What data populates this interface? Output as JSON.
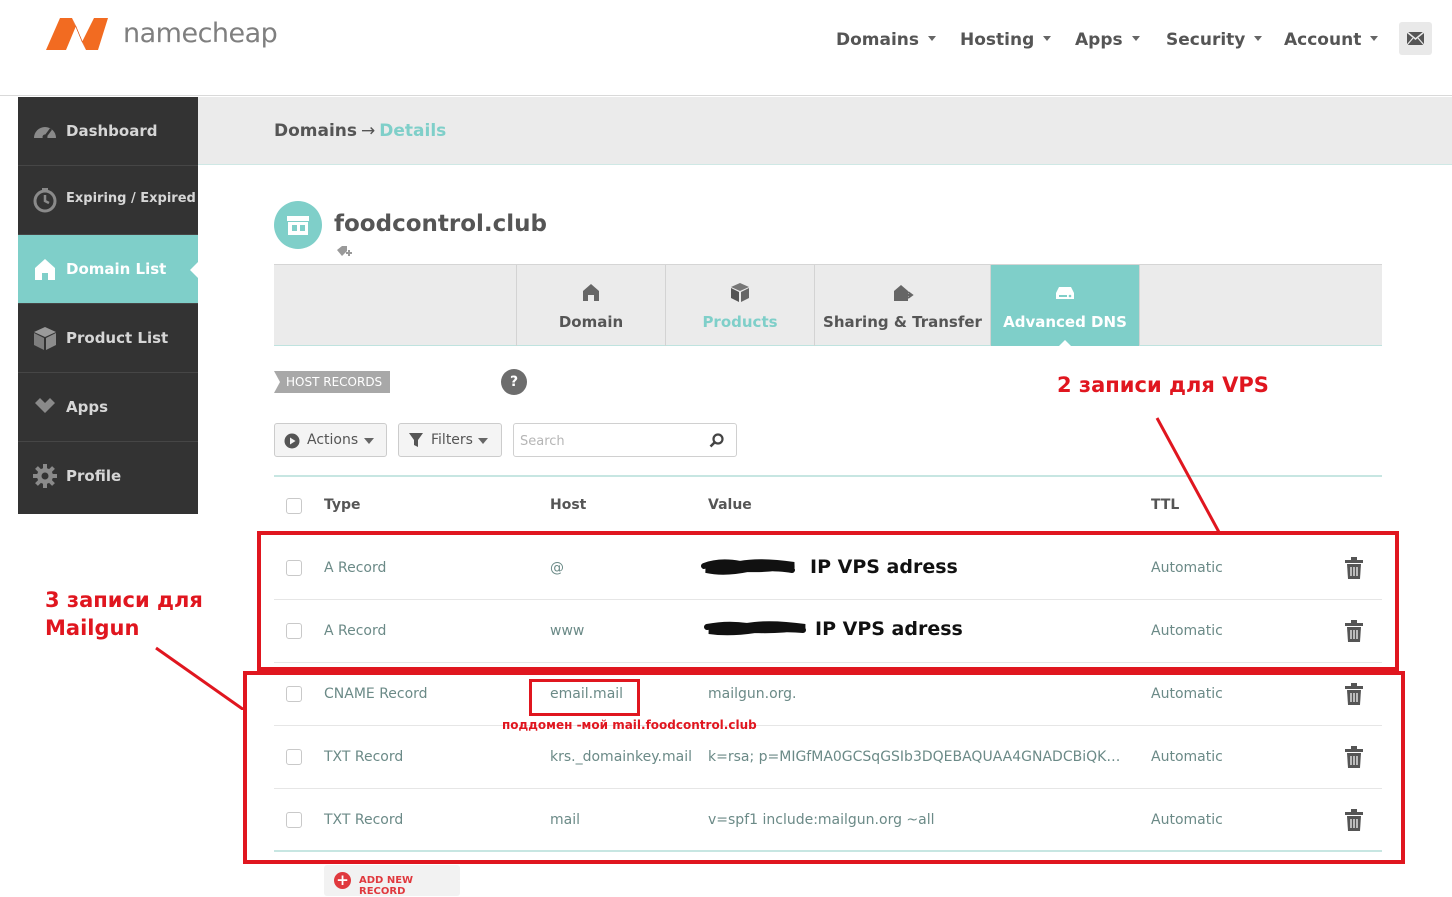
{
  "brand": {
    "name": "namecheap"
  },
  "nav": {
    "items": [
      "Domains",
      "Hosting",
      "Apps",
      "Security",
      "Account"
    ],
    "mail_icon": "envelope-icon"
  },
  "sidebar": {
    "items": [
      {
        "label": "Dashboard",
        "icon": "speedometer-icon"
      },
      {
        "label": "Expiring / Expired",
        "icon": "clock-icon"
      },
      {
        "label": "Domain List",
        "icon": "home-icon",
        "active": true
      },
      {
        "label": "Product List",
        "icon": "box-icon"
      },
      {
        "label": "Apps",
        "icon": "apps-icon"
      },
      {
        "label": "Profile",
        "icon": "gear-icon"
      }
    ]
  },
  "breadcrumb": {
    "section": "Domains",
    "arrow": "→",
    "page": "Details"
  },
  "domain": {
    "name": "foodcontrol.club"
  },
  "tabs": [
    {
      "label": "Domain",
      "icon": "home-icon"
    },
    {
      "label": "Products",
      "icon": "box-icon"
    },
    {
      "label": "Sharing & Transfer",
      "icon": "share-icon"
    },
    {
      "label": "Advanced DNS",
      "icon": "dns-icon",
      "active": true
    }
  ],
  "host_records": {
    "label": "HOST RECORDS",
    "help": "?"
  },
  "toolbar": {
    "actions_label": "Actions",
    "filters_label": "Filters",
    "search_placeholder": "Search"
  },
  "table": {
    "headers": {
      "type": "Type",
      "host": "Host",
      "value": "Value",
      "ttl": "TTL"
    },
    "rows": [
      {
        "type": "A Record",
        "host": "@",
        "value": "",
        "ttl": "Automatic"
      },
      {
        "type": "A Record",
        "host": "www",
        "value": "",
        "ttl": "Automatic"
      },
      {
        "type": "CNAME Record",
        "host": "email.mail",
        "value": "mailgun.org.",
        "ttl": "Automatic"
      },
      {
        "type": "TXT Record",
        "host": "krs._domainkey.mail",
        "value": "k=rsa; p=MIGfMA0GCSqGSIb3DQEBAQUAA4GNADCBiQKBgQ...",
        "ttl": "Automatic"
      },
      {
        "type": "TXT Record",
        "host": "mail",
        "value": "v=spf1 include:mailgun.org ~all",
        "ttl": "Automatic"
      }
    ]
  },
  "add_record_label": "ADD NEW RECORD",
  "annotations": {
    "vps_title": "2 записи для VPS",
    "mailgun_line1": "3 записи для",
    "mailgun_line2": "Mailgun",
    "ip_1": "IP VPS adress",
    "ip_2": "IP VPS adress",
    "subdomain_note": "поддомен -мой mail.foodcontrol.club"
  },
  "colors": {
    "accent": "#7fcfc9",
    "annotation_red": "#e0161f",
    "sidebar_bg": "#333333"
  }
}
